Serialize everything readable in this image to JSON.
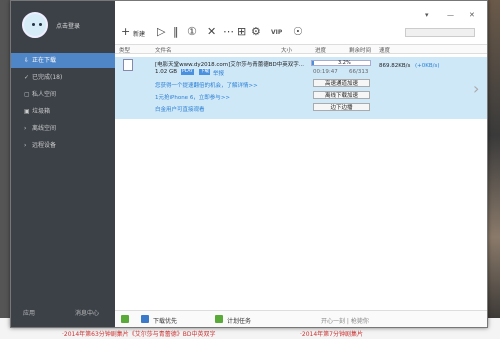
{
  "sidebar": {
    "username": "点击登录",
    "items": [
      {
        "icon": "⇩",
        "label": "正在下载"
      },
      {
        "icon": "✓",
        "label": "已完成(18)"
      },
      {
        "icon": "▢",
        "label": "私人空间"
      },
      {
        "icon": "▣",
        "label": "垃圾箱"
      },
      {
        "icon": "›",
        "label": "离线空间"
      },
      {
        "icon": "›",
        "label": "远程设备"
      }
    ],
    "apps": "应用",
    "msg": "消息中心"
  },
  "toolbar": {
    "new_label": "新建",
    "vip": "VIP"
  },
  "columns": {
    "type": "类型",
    "name": "文件名",
    "size": "大小",
    "progress": "进度",
    "remaining": "剩余时间",
    "speed": "速度"
  },
  "task": {
    "title": "[电影天堂www.dy2018.com]艾尔莎与青蕾德BD中英双字...",
    "size": "1.02 GB",
    "badge_play": "PLAY",
    "badge_hd": "下载",
    "tag": "举报",
    "progress_text": "3.2%",
    "progress": 0.032,
    "elapsed": "00:19:47",
    "count": "66/313",
    "speed": "869.82KB/s",
    "speed_extra": "(+0KB/s)",
    "promo1": "您获得一个提速翻倍的机会，了解详情>>",
    "promo2": "1元抢iPhone 6，立即参与>>",
    "promo3": "白金用户可直接观看",
    "btn1": "高速通道加速",
    "btn2": "离线下载加速",
    "btn3": "边下边播"
  },
  "status": {
    "priority": "下载优先",
    "plan": "计划任务",
    "right": "开心一刻 | 枪毙你"
  },
  "background": {
    "caption1": "·2014年第63分钟剧集片《艾尔莎与青蕾德》BD中英双字",
    "caption2": "·2014年第7分钟剧集片"
  }
}
